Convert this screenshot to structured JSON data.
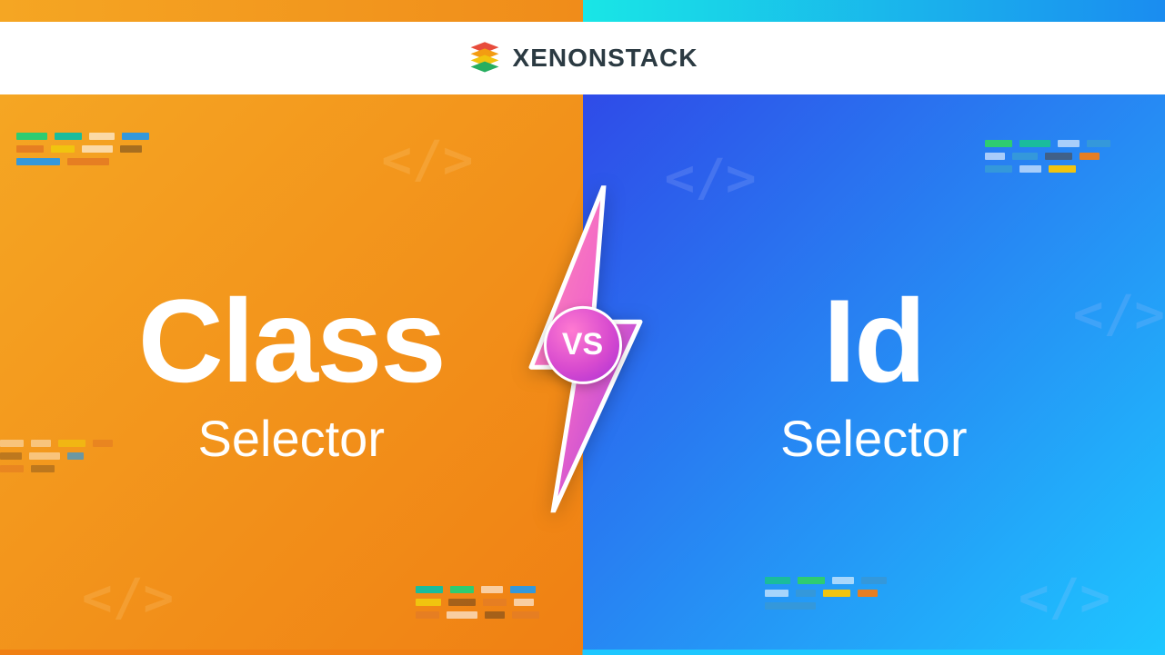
{
  "brand": {
    "name": "XENONSTACK"
  },
  "left": {
    "title": "Class",
    "subtitle": "Selector"
  },
  "right": {
    "title": "Id",
    "subtitle": "Selector"
  },
  "vs": {
    "label": "VS"
  },
  "code_tag_glyph": "</>"
}
